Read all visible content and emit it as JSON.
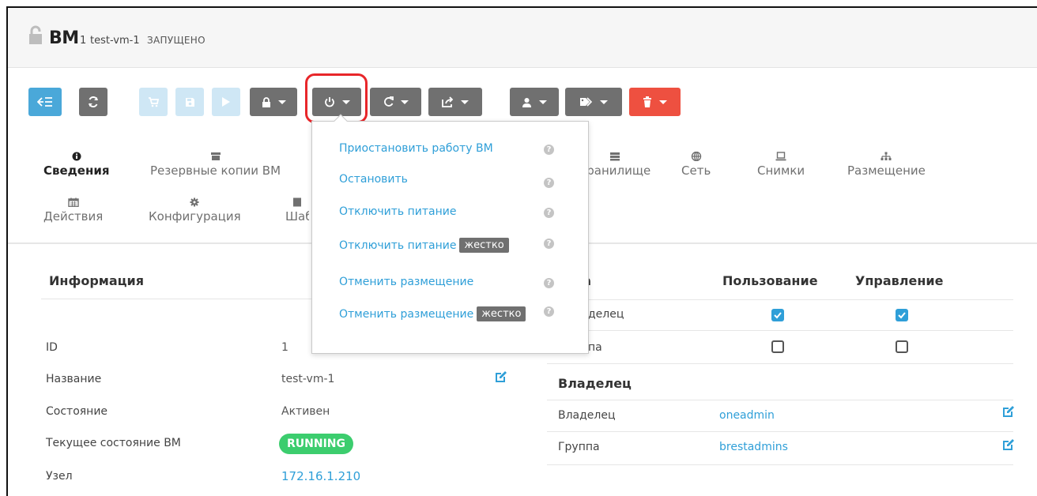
{
  "header": {
    "title": "ВМ",
    "vm_id": "1",
    "vm_name": "test-vm-1",
    "vm_state": "ЗАПУЩЕНО"
  },
  "tabs": {
    "row1": [
      "Сведения",
      "Резервные копии ВМ",
      "Хранилище",
      "Сеть",
      "Снимки",
      "Размещение"
    ],
    "row2": [
      "Действия",
      "Конфигурация",
      "Шаблон"
    ]
  },
  "power_menu": {
    "items": [
      {
        "label": "Приостановить работу ВМ",
        "badge": ""
      },
      {
        "label": "Остановить",
        "badge": ""
      },
      {
        "label": "Отключить питание",
        "badge": ""
      },
      {
        "label": "Отключить питание",
        "badge": "жестко"
      },
      {
        "label": "Отменить размещение",
        "badge": ""
      },
      {
        "label": "Отменить размещение",
        "badge": "жестко"
      }
    ]
  },
  "info": {
    "title": "Информация",
    "rows": [
      {
        "label": "ID",
        "value": "1"
      },
      {
        "label": "Название",
        "value": "test-vm-1"
      },
      {
        "label": "Состояние",
        "value": "Активен"
      },
      {
        "label": "Текущее состояние ВМ",
        "value": "RUNNING"
      },
      {
        "label": "Узел",
        "value": "172.16.1.210"
      }
    ]
  },
  "permissions": {
    "title_fragment": "за",
    "col_use": "Пользование",
    "col_manage": "Управление",
    "rows": [
      {
        "label": "делец",
        "use": true,
        "manage": true
      },
      {
        "label": "па",
        "use": false,
        "manage": false
      }
    ]
  },
  "ownership": {
    "title": "Владелец",
    "rows": [
      {
        "label": "Владелец",
        "value": "oneadmin"
      },
      {
        "label": "Группа",
        "value": "brestadmins"
      }
    ]
  },
  "colors": {
    "blue": "#4aa8d9",
    "grey": "#707070",
    "red": "#ee5040",
    "green": "#3ccd6e",
    "link": "#2f9fd8",
    "highlight": "#e8262a"
  }
}
